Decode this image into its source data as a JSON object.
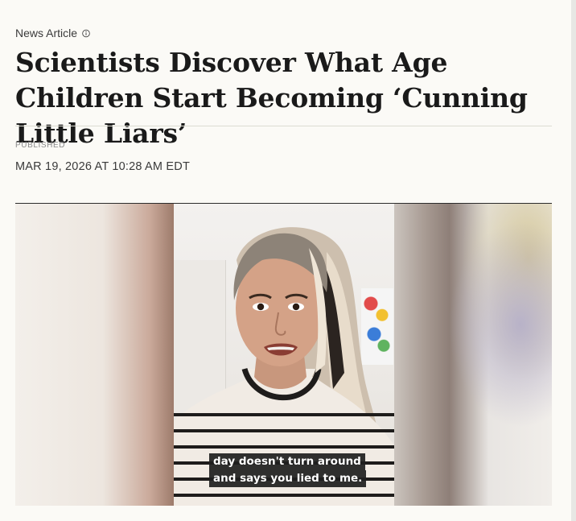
{
  "article": {
    "kind_label": "News Article",
    "title": "Scientists Discover What Age Children Start Becoming ‘Cunning Little Liars’",
    "published_label": "PUBLISHED",
    "published_date": "MAR 19, 2026 AT 10:28 AM EDT"
  },
  "video": {
    "caption_line_1": "day doesn't turn around",
    "caption_line_2": "and says you lied to me."
  },
  "icons": {
    "info": "info-circle-icon"
  }
}
